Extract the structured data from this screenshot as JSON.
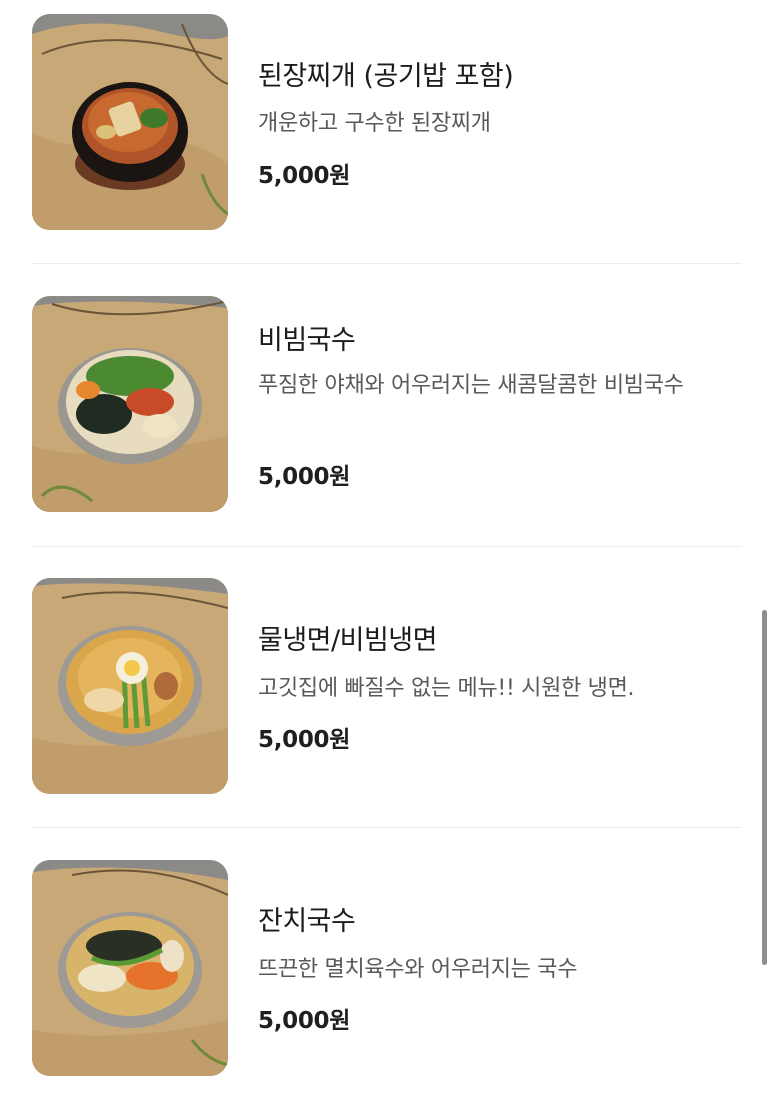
{
  "menu": {
    "items": [
      {
        "name": "된장찌개 (공기밥 포함)",
        "description": "개운하고 구수한 된장찌개",
        "price": "5,000원",
        "image_icon": "doenjang-jjigae-photo"
      },
      {
        "name": "비빔국수",
        "description": "푸짐한 야채와 어우러지는 새콤달콤한 비빔국수",
        "price": "5,000원",
        "image_icon": "bibim-guksu-photo"
      },
      {
        "name": "물냉면/비빔냉면",
        "description": "고깃집에 빠질수 없는 메뉴!! 시원한 냉면.",
        "price": "5,000원",
        "image_icon": "naengmyeon-photo"
      },
      {
        "name": "잔치국수",
        "description": "뜨끈한 멸치육수와 어우러지는 국수",
        "price": "5,000원",
        "image_icon": "janchi-guksu-photo"
      }
    ]
  },
  "colors": {
    "burlap": "#c9a877",
    "stone_background": "#8c8a86",
    "divider": "#ececec"
  }
}
